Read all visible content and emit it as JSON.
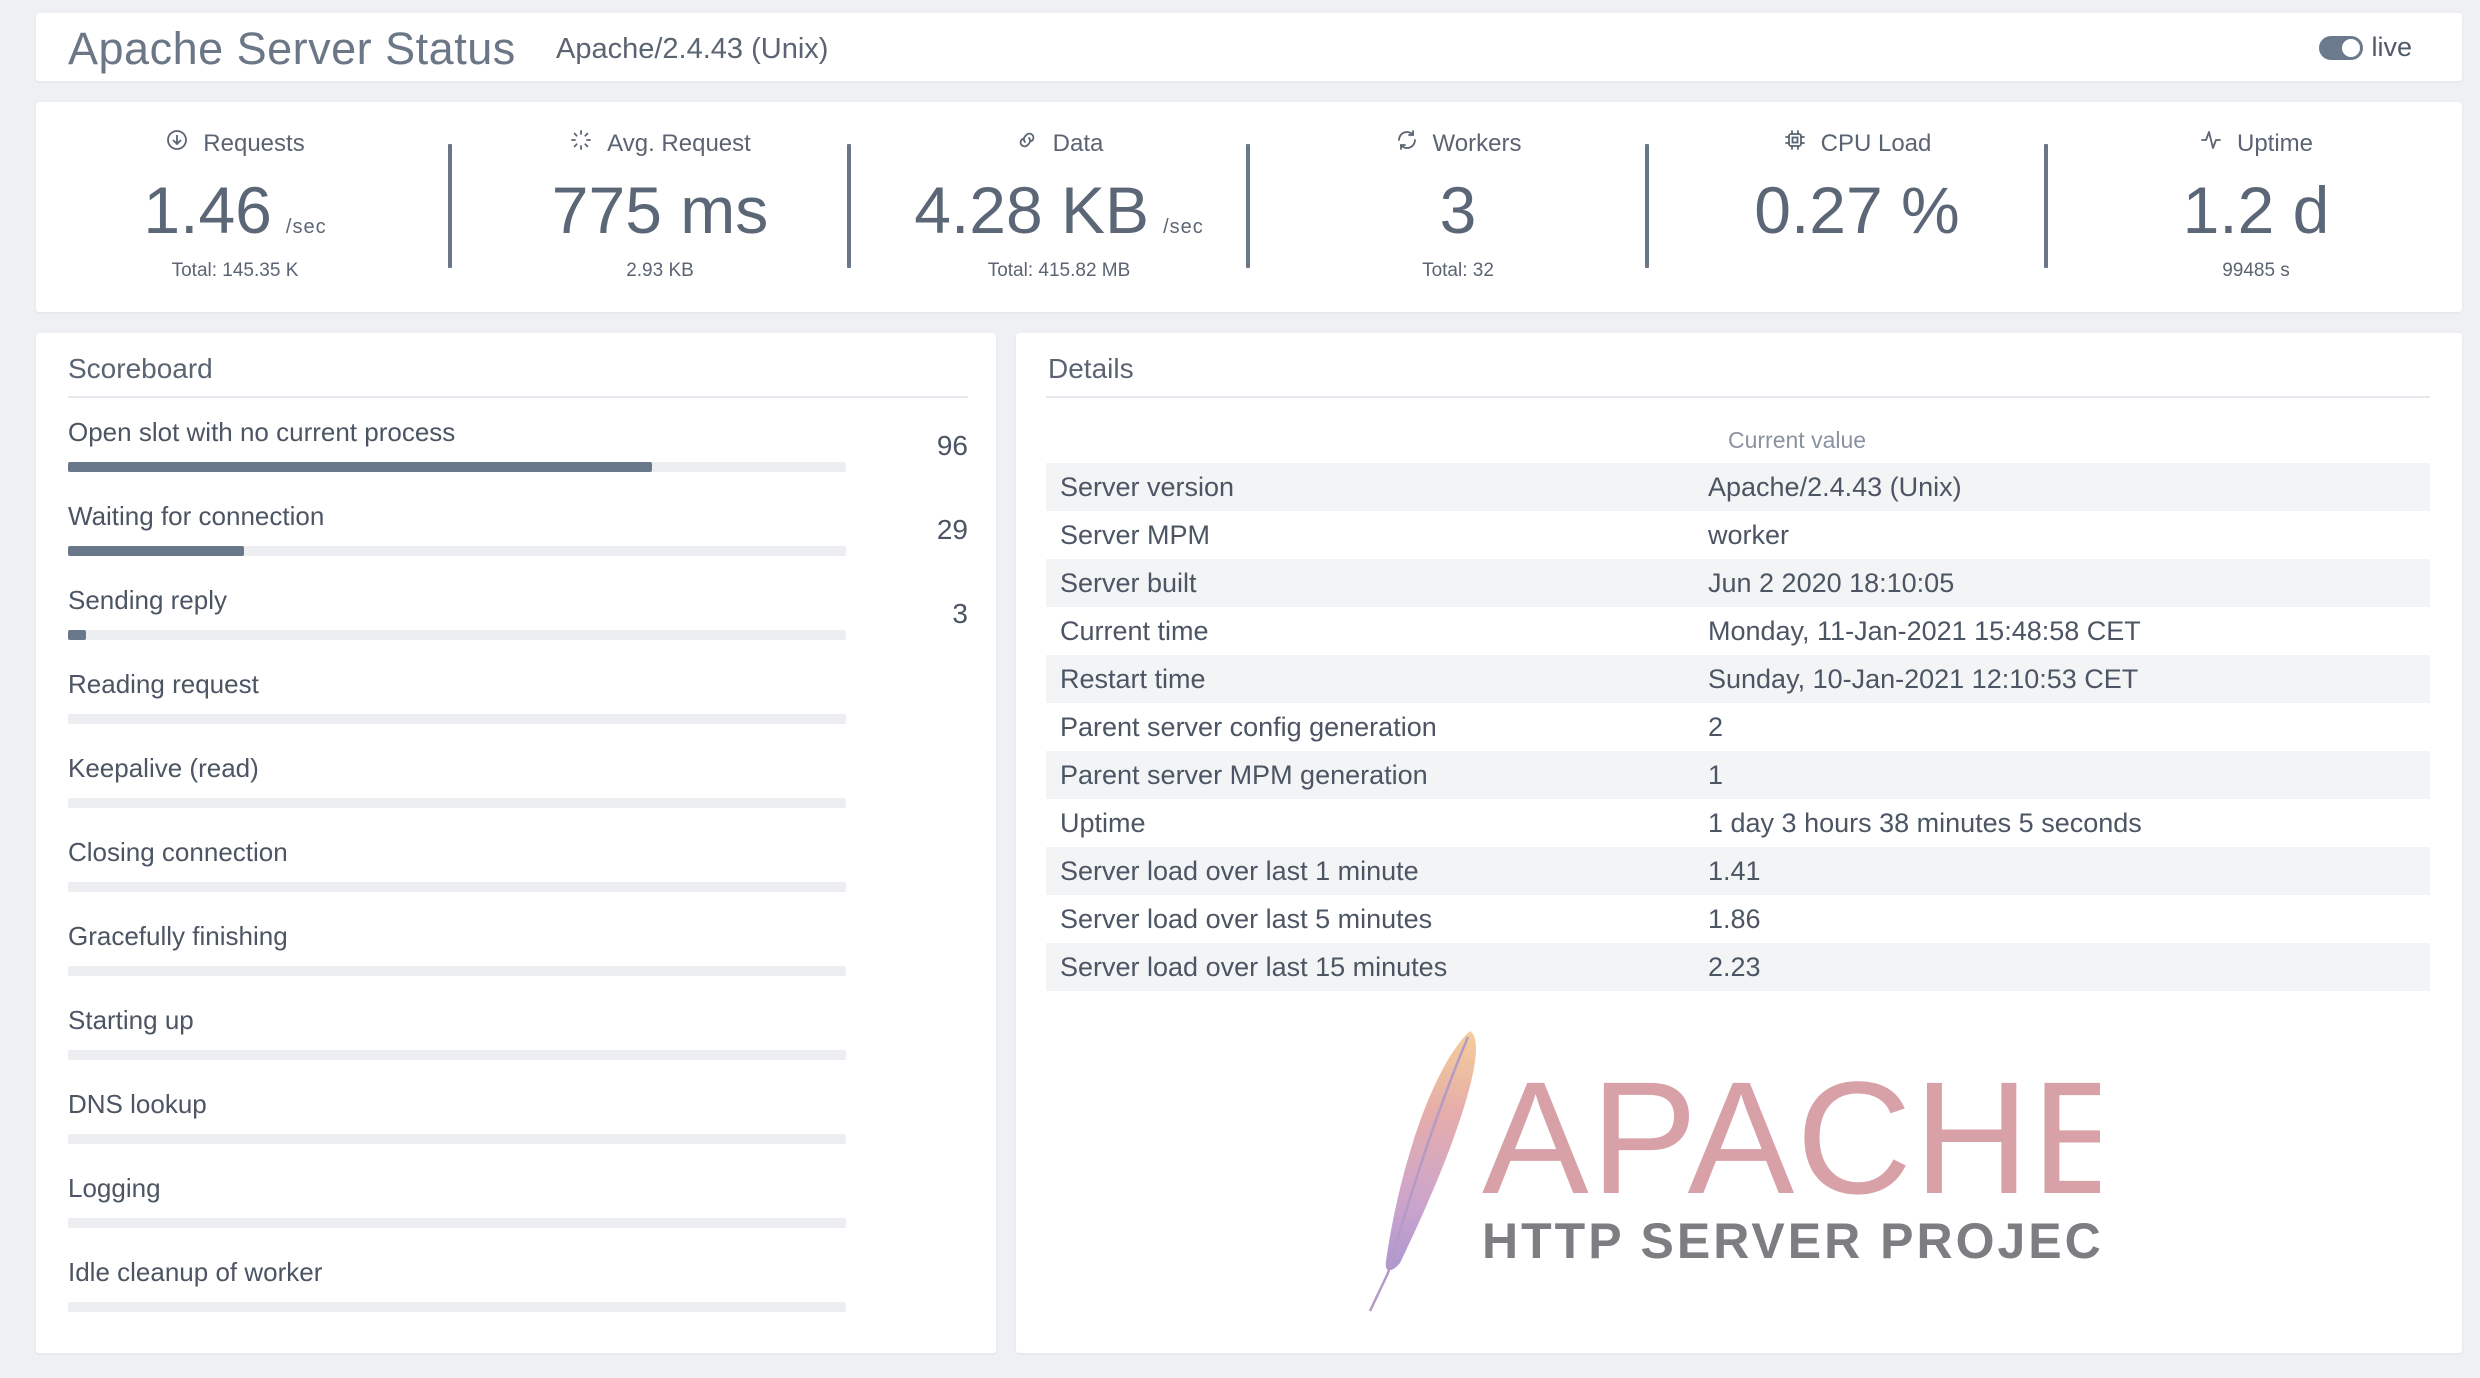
{
  "header": {
    "title": "Apache Server Status",
    "subtitle": "Apache/2.4.43 (Unix)",
    "live_label": "live"
  },
  "stats": [
    {
      "label": "Requests",
      "icon": "download-circle-icon",
      "value": "1.46",
      "unit": "/sec",
      "sub": "Total: 145.35 K"
    },
    {
      "label": "Avg. Request",
      "icon": "spinner-icon",
      "value": "775 ms",
      "unit": "",
      "sub": "2.93 KB"
    },
    {
      "label": "Data",
      "icon": "link-icon",
      "value": "4.28 KB",
      "unit": "/sec",
      "sub": "Total: 415.82 MB"
    },
    {
      "label": "Workers",
      "icon": "refresh-icon",
      "value": "3",
      "unit": "",
      "sub": "Total: 32"
    },
    {
      "label": "CPU Load",
      "icon": "cpu-icon",
      "value": "0.27 %",
      "unit": "",
      "sub": ""
    },
    {
      "label": "Uptime",
      "icon": "activity-icon",
      "value": "1.2 d",
      "unit": "",
      "sub": "99485 s"
    }
  ],
  "scoreboard": {
    "title": "Scoreboard",
    "max": 128,
    "items": [
      {
        "label": "Open slot with no current process",
        "count": 96
      },
      {
        "label": "Waiting for connection",
        "count": 29
      },
      {
        "label": "Sending reply",
        "count": 3
      },
      {
        "label": "Reading request",
        "count": null
      },
      {
        "label": "Keepalive (read)",
        "count": null
      },
      {
        "label": "Closing connection",
        "count": null
      },
      {
        "label": "Gracefully finishing",
        "count": null
      },
      {
        "label": "Starting up",
        "count": null
      },
      {
        "label": "DNS lookup",
        "count": null
      },
      {
        "label": "Logging",
        "count": null
      },
      {
        "label": "Idle cleanup of worker",
        "count": null
      }
    ]
  },
  "details": {
    "title": "Details",
    "column_header": "Current value",
    "rows": [
      {
        "key": "Server version",
        "value": "Apache/2.4.43 (Unix)"
      },
      {
        "key": "Server MPM",
        "value": "worker"
      },
      {
        "key": "Server built",
        "value": "Jun 2 2020 18:10:05"
      },
      {
        "key": "Current time",
        "value": "Monday, 11-Jan-2021 15:48:58 CET"
      },
      {
        "key": "Restart time",
        "value": "Sunday, 10-Jan-2021 12:10:53 CET"
      },
      {
        "key": "Parent server config generation",
        "value": "2"
      },
      {
        "key": "Parent server MPM generation",
        "value": "1"
      },
      {
        "key": "Uptime",
        "value": "1 day 3 hours 38 minutes 5 seconds"
      },
      {
        "key": "Server load over last 1 minute",
        "value": "1.41"
      },
      {
        "key": "Server load over last 5 minutes",
        "value": "1.86"
      },
      {
        "key": "Server load over last 15 minutes",
        "value": "2.23"
      }
    ]
  },
  "logo": {
    "word": "APACHE",
    "tagline": "HTTP SERVER PROJECT"
  },
  "colors": {
    "accent": "#69778a",
    "background": "#eef0f3",
    "logo_word": "#d7a1a7",
    "logo_tagline": "#7d7d82"
  }
}
